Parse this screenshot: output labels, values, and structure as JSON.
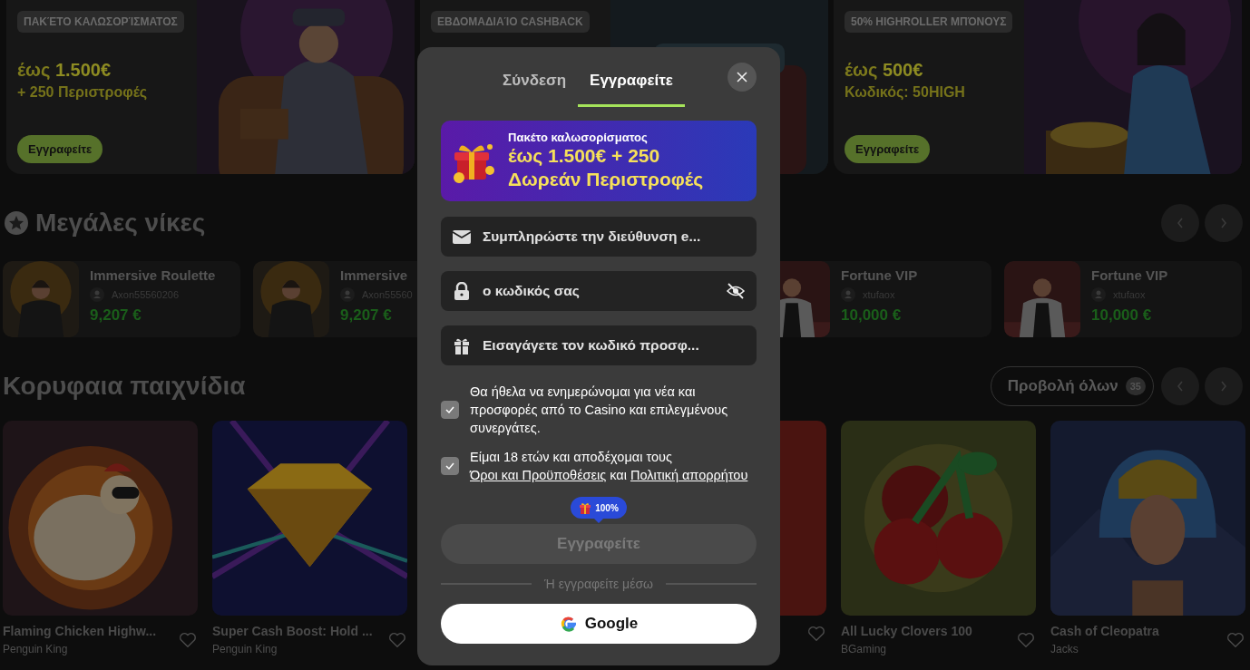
{
  "banners": [
    {
      "badge": "ΠΑΚΈΤΟ ΚΑΛΩΣΟΡΊΣΜΑΤΟΣ",
      "headline": "έως **1.500€**",
      "subline": "+ 250 Περιστροφές",
      "button": "Εγγραφείτε"
    },
    {
      "badge": "ΕΒΔΟΜΑΔΙΑΊΟ CASHBACK"
    },
    {
      "badge": "50% HIGHROLLER ΜΠΌΝΟΥΣ",
      "headline": "έως **500€**",
      "subline": "Κωδικός: 50HIGH",
      "button": "Εγγραφείτε"
    }
  ],
  "big_wins": {
    "title": "Μεγάλες νίκες",
    "items": [
      {
        "kind": "card",
        "game": "Immersive Roulette",
        "player": "Axon55560206",
        "amount": "9,207 €"
      },
      {
        "kind": "card",
        "game": "Immersive",
        "player": "Axon55560",
        "amount": "9,207 €"
      },
      {
        "kind": "covered"
      },
      {
        "kind": "card",
        "game": "Fortune VIP",
        "player": "xtufaox",
        "amount": "10,000 €"
      },
      {
        "kind": "card",
        "game": "Fortune VIP",
        "player": "xtufaox",
        "amount": "10,000 €"
      }
    ]
  },
  "top_games": {
    "title": "Κορυφαια παιχνίδια",
    "view_all": "Προβολή όλων",
    "count": "35",
    "items": [
      {
        "kind": "game",
        "title": "Flaming Chicken Highw...",
        "provider": "Penguin King"
      },
      {
        "kind": "game",
        "title": "Super Cash Boost: Hold ...",
        "provider": "Penguin King"
      },
      {
        "kind": "covered"
      },
      {
        "kind": "partial"
      },
      {
        "kind": "game",
        "title": "All Lucky Clovers 100",
        "provider": "BGaming"
      },
      {
        "kind": "game",
        "title": "Cash of Cleopatra",
        "provider": "Jacks"
      }
    ]
  },
  "modal": {
    "tabs": [
      {
        "label": "Σύνδεση",
        "selected": false
      },
      {
        "label": "Εγγραφείτε",
        "selected": true
      }
    ],
    "promo": {
      "title": "Πακέτο καλωσορίσματος",
      "offer": "έως 1.500€ + 250",
      "offer_line_2": "Δωρεάν Περιστροφές"
    },
    "fields": [
      {
        "kind": "email",
        "placeholder": "Συμπληρώστε την διεύθυνση e..."
      },
      {
        "kind": "password",
        "placeholder": "ο κωδικός σας"
      },
      {
        "kind": "promo_code",
        "placeholder": "Εισαγάγετε τον κωδικό προσφ..."
      }
    ],
    "consents": [
      {
        "text": "Θα ήθελα να ενημερώνομαι για νέα και προσφορές από το Casino και επιλεγμένους συνεργάτες.",
        "checked": true
      },
      {
        "text": "Είμαι 18 ετών και αποδέχομαι τους ",
        "links": [
          "Όροι και Προϋποθέσεις",
          "Πολιτική απορρήτου"
        ],
        "joiner": " και ",
        "checked": true
      }
    ],
    "bonus_badge": "100%",
    "submit": {
      "label": "Εγγραφείτε",
      "disabled": true
    },
    "divider": "Ή εγγραφείτε μέσω",
    "google": "Google"
  }
}
